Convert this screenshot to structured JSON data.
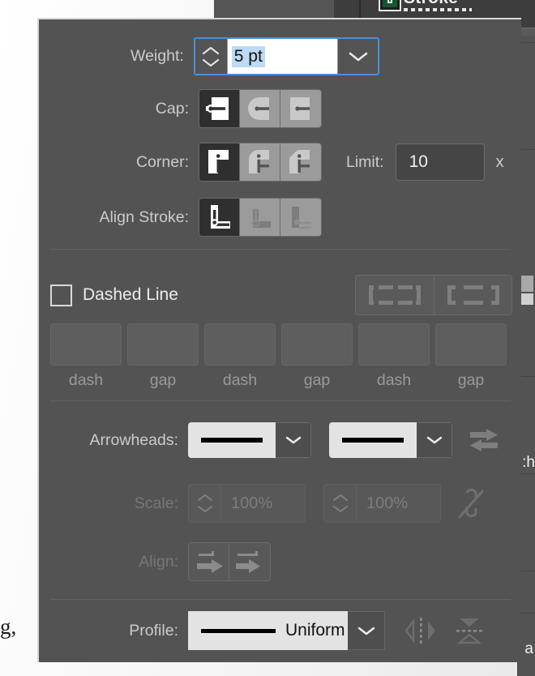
{
  "app": {
    "panel_title": "Stroke",
    "background_text_left": "g,",
    "background_text_right_1": ":h",
    "background_text_right_2": "a",
    "accent_focus_color": "#4a90d9",
    "panel_bg_color": "#535353",
    "selected_button_color": "#2f2f2f",
    "stroke_swatch_color": "#12582e"
  },
  "weight": {
    "label": "Weight:",
    "value": "5 pt",
    "placeholder": "5 pt",
    "stepper_up_icon": "chevron-up-icon",
    "stepper_down_icon": "chevron-down-icon",
    "dropdown_icon": "chevron-down-icon",
    "selected": true
  },
  "cap": {
    "label": "Cap:",
    "options": [
      {
        "name": "butt-cap",
        "selected": true
      },
      {
        "name": "round-cap",
        "selected": false
      },
      {
        "name": "projecting-cap",
        "selected": false
      }
    ]
  },
  "corner": {
    "label": "Corner:",
    "options": [
      {
        "name": "miter-join",
        "selected": true
      },
      {
        "name": "round-join",
        "selected": false
      },
      {
        "name": "bevel-join",
        "selected": false
      }
    ],
    "limit_label": "Limit:",
    "limit_value": "10",
    "limit_unit": "x"
  },
  "align_stroke": {
    "label": "Align Stroke:",
    "options": [
      {
        "name": "align-stroke-center",
        "selected": true,
        "disabled": false
      },
      {
        "name": "align-stroke-inside",
        "selected": false,
        "disabled": true
      },
      {
        "name": "align-stroke-outside",
        "selected": false,
        "disabled": true
      }
    ]
  },
  "dashed_line": {
    "label": "Dashed Line",
    "checked": false,
    "dash_align_options": [
      {
        "name": "dashes-preserve-exact-lengths",
        "selected": false
      },
      {
        "name": "dashes-adjust-to-corners",
        "selected": false
      }
    ],
    "fields": [
      {
        "caption": "dash",
        "value": "",
        "disabled": true
      },
      {
        "caption": "gap",
        "value": "",
        "disabled": true
      },
      {
        "caption": "dash",
        "value": "",
        "disabled": true
      },
      {
        "caption": "gap",
        "value": "",
        "disabled": true
      },
      {
        "caption": "dash",
        "value": "",
        "disabled": true
      },
      {
        "caption": "gap",
        "value": "",
        "disabled": true
      }
    ]
  },
  "arrowheads": {
    "label": "Arrowheads:",
    "start": {
      "preview": "plain-line",
      "dropdown_icon": "chevron-down-icon"
    },
    "end": {
      "preview": "plain-line",
      "dropdown_icon": "chevron-down-icon"
    },
    "swap_icon": "swap-arrowheads-icon",
    "swap_disabled": true
  },
  "scale": {
    "label": "Scale:",
    "start_value": "100%",
    "end_value": "100%",
    "disabled": true,
    "link_icon": "broken-link-icon",
    "link_disabled": true
  },
  "align": {
    "label": "Align:",
    "options": [
      {
        "name": "extend-arrow-beyond-end",
        "selected": false,
        "disabled": true
      },
      {
        "name": "place-arrow-at-end",
        "selected": false,
        "disabled": true
      }
    ]
  },
  "profile": {
    "label": "Profile:",
    "value": "Uniform",
    "dropdown_icon": "chevron-down-icon",
    "flip_along_icon": "flip-along-icon",
    "flip_across_icon": "flip-across-icon",
    "flip_disabled": true
  }
}
